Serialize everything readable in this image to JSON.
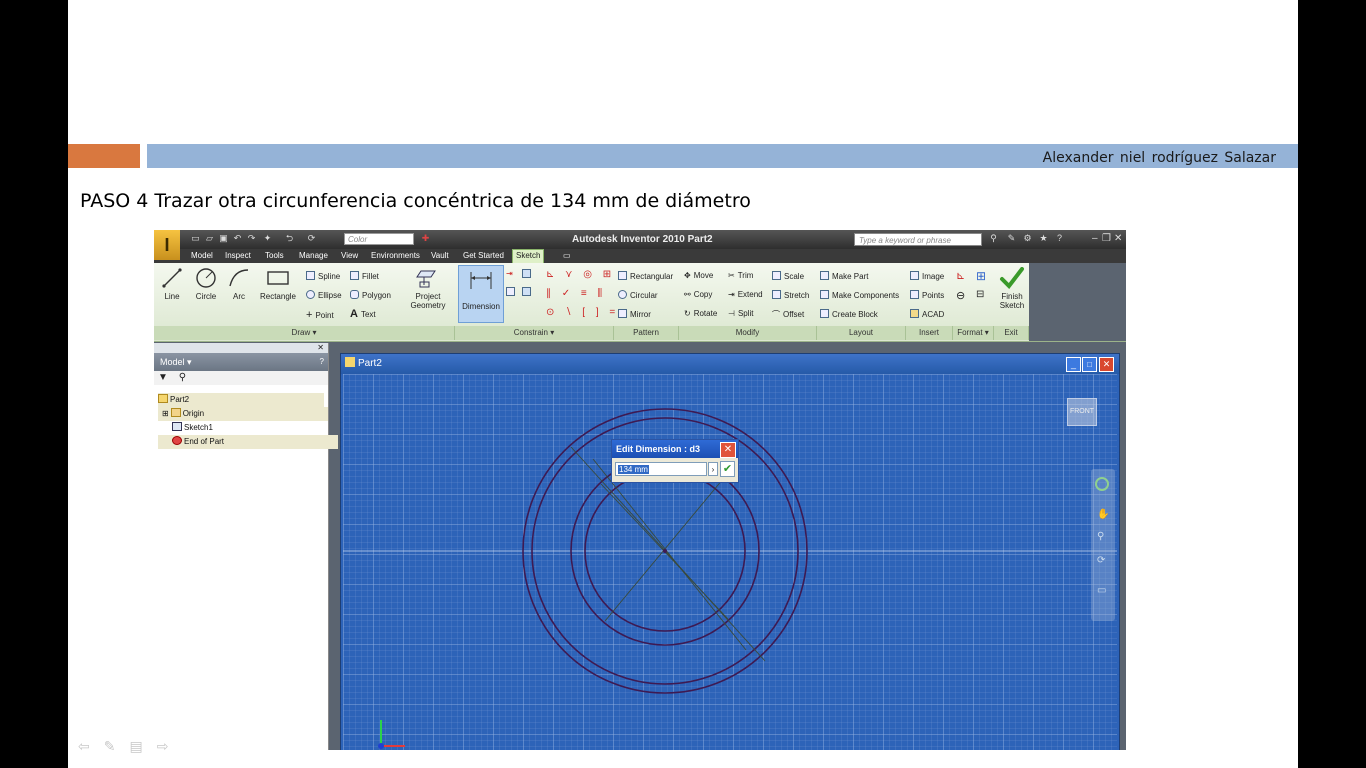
{
  "slide": {
    "author": "Alexander niel rodríguez Salazar",
    "heading": "PASO 4 Trazar otra circunferencia concéntrica de 134 mm de diámetro",
    "accent_orange": "#d9783f",
    "accent_blue": "#95b3d7"
  },
  "app": {
    "title": "Autodesk Inventor 2010    Part2",
    "color_placeholder": "Color",
    "search_placeholder": "Type a keyword or phrase",
    "menu_tabs": [
      "Model",
      "Inspect",
      "Tools",
      "Manage",
      "View",
      "Environments",
      "Vault",
      "Get Started",
      "Sketch"
    ],
    "active_tab": "Sketch"
  },
  "ribbon": {
    "draw": {
      "line": "Line",
      "circle": "Circle",
      "arc": "Arc",
      "rectangle": "Rectangle",
      "spline": "Spline",
      "fillet": "Fillet",
      "ellipse": "Ellipse",
      "polygon": "Polygon",
      "point": "Point",
      "text": "Text",
      "project_geometry_1": "Project",
      "project_geometry_2": "Geometry"
    },
    "constrain": {
      "dimension": "Dimension"
    },
    "pattern": {
      "rectangular": "Rectangular",
      "circular": "Circular",
      "mirror": "Mirror"
    },
    "modify": {
      "move": "Move",
      "trim": "Trim",
      "scale": "Scale",
      "copy": "Copy",
      "extend": "Extend",
      "stretch": "Stretch",
      "rotate": "Rotate",
      "split": "Split",
      "offset": "Offset"
    },
    "layout": {
      "make_part": "Make Part",
      "make_components": "Make Components",
      "create_block": "Create Block"
    },
    "insert": {
      "image": "Image",
      "points": "Points",
      "acad": "ACAD"
    },
    "exit": {
      "finish_1": "Finish",
      "finish_2": "Sketch"
    },
    "panels": {
      "draw": "Draw ▾",
      "constrain": "Constrain ▾",
      "pattern": "Pattern",
      "modify": "Modify",
      "layout": "Layout",
      "insert": "Insert",
      "format": "Format ▾",
      "exit": "Exit"
    }
  },
  "browser": {
    "header": "Model ▾",
    "items": [
      "Part2",
      "Origin",
      "Sketch1",
      "End of Part"
    ]
  },
  "viewport": {
    "title": "Part2",
    "viewcube_label": "FRONT",
    "dialog_title": "Edit Dimension : d3",
    "dim_value": "134 mm"
  }
}
